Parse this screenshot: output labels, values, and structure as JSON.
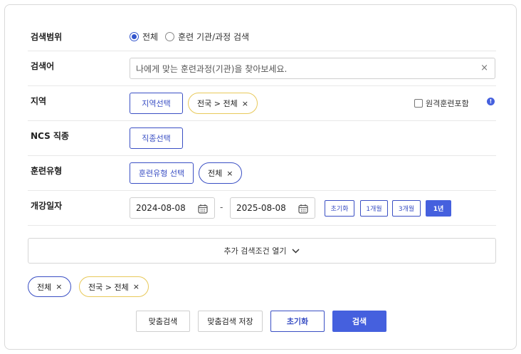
{
  "scope": {
    "label": "검색범위",
    "options": [
      {
        "label": "전체",
        "selected": true
      },
      {
        "label": "훈련 기관/과정 검색",
        "selected": false
      }
    ]
  },
  "keyword": {
    "label": "검색어",
    "placeholder": "나에게 맞는 훈련과정(기관)을 찾아보세요.",
    "clear": "×"
  },
  "region": {
    "label": "지역",
    "select_button": "지역선택",
    "chip": "전국 > 전체",
    "remote_checkbox": "원격훈련포함",
    "remote_checked": false,
    "info_icon": "!"
  },
  "ncs": {
    "label": "NCS 직종",
    "select_button": "직종선택"
  },
  "training_type": {
    "label": "훈련유형",
    "select_button": "훈련유형 선택",
    "chip": "전체"
  },
  "date": {
    "label": "개강일자",
    "start": "2024-08-08",
    "end": "2025-08-08",
    "separator": "-",
    "presets": [
      {
        "label": "초기화",
        "active": false
      },
      {
        "label": "1개월",
        "active": false
      },
      {
        "label": "3개월",
        "active": false
      },
      {
        "label": "1년",
        "active": true
      }
    ]
  },
  "more": {
    "label": "추가 검색조건 열기"
  },
  "selected_chips": [
    "전체",
    "전국 > 전체"
  ],
  "chip_close": "×",
  "actions": {
    "match_search": "맞춤검색",
    "save_match": "맞춤검색 저장",
    "reset": "초기화",
    "search": "검색"
  },
  "colors": {
    "accent": "#4560de",
    "chip_yellow": "#e8c95a"
  }
}
